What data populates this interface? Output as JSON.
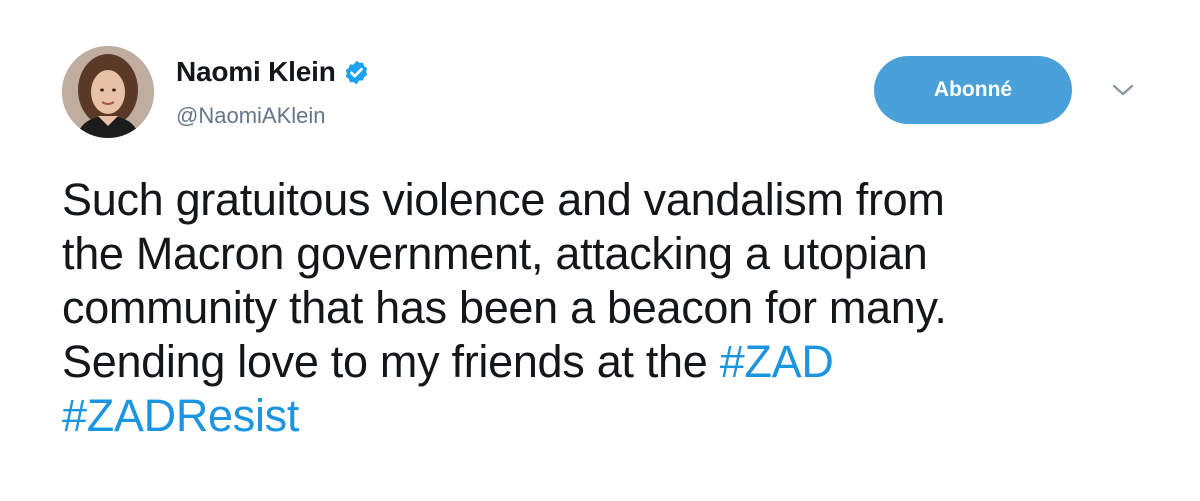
{
  "author": {
    "name": "Naomi Klein",
    "handle": "@NaomiAKlein",
    "verified_icon": "verified-badge-icon"
  },
  "follow_button": {
    "label": "Abonné"
  },
  "menu": {
    "icon": "chevron-down-icon"
  },
  "tweet": {
    "line1": "Such gratuitous violence and vandalism from",
    "line2": "the Macron government, attacking a utopian",
    "line3": "community that has been a beacon for many.",
    "line4_text": "Sending love to my friends at the ",
    "hashtag1": "#ZAD",
    "hashtag2": "#ZADResist"
  },
  "colors": {
    "follow_button_bg": "#4aa1d9",
    "hashtag": "#1b95e0",
    "verified_badge": "#1da1f2",
    "handle": "#657786"
  }
}
